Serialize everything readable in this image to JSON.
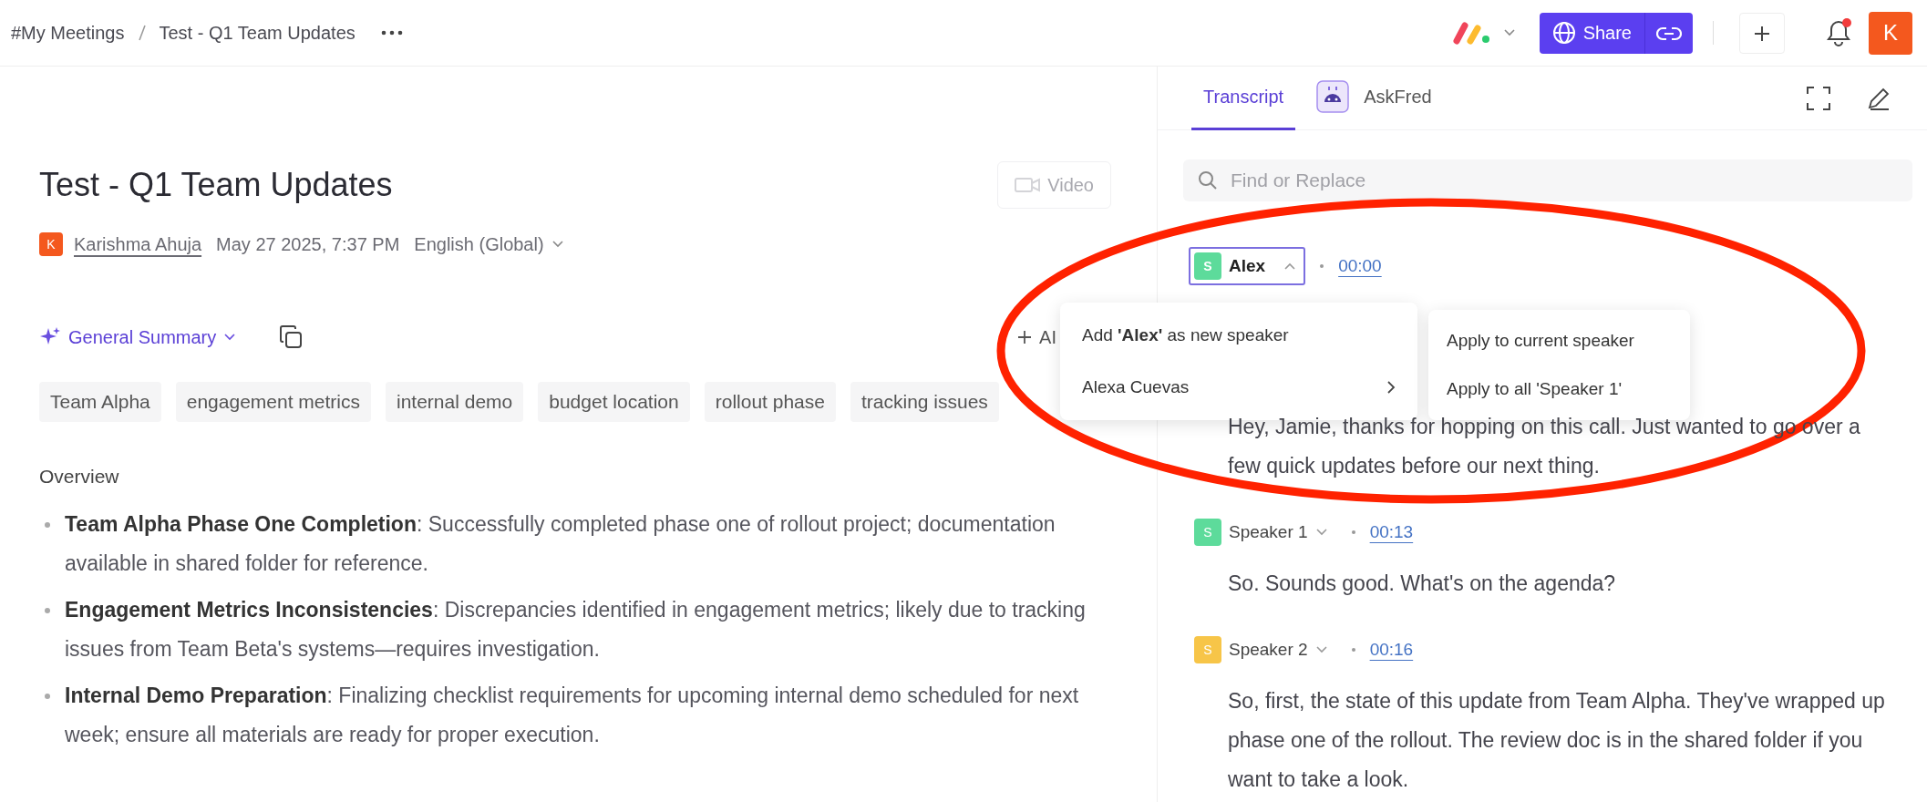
{
  "breadcrumb": [
    {
      "label": "#My Meetings"
    },
    {
      "label": "Test - Q1 Team Updates"
    }
  ],
  "topbar": {
    "share_label": "Share",
    "avatar": "K"
  },
  "meeting": {
    "title": "Test - Q1 Team Updates",
    "video": {
      "label": "Video",
      "disabled": true
    },
    "owner_initial": "K",
    "owner": "Karishma Ahuja",
    "date": "May 27 2025, 7:37 PM",
    "language": "English (Global)"
  },
  "summary": {
    "label": "General Summary",
    "ai_label": "AI",
    "tags": [
      "Team Alpha",
      "engagement metrics",
      "internal demo",
      "budget location",
      "rollout phase",
      "tracking issues"
    ],
    "section": "Overview",
    "bullets": [
      "**Team Alpha Phase One Completion**: Successfully completed phase one of rollout project; documentation available in shared folder for reference.",
      "**Engagement Metrics Inconsistencies**: Discrepancies identified in engagement metrics; likely due to tracking issues from Team Beta's systems—requires investigation.",
      "**Internal Demo Preparation**: Finalizing checklist requirements for upcoming internal demo scheduled for next week; ensure all materials are ready for proper execution."
    ]
  },
  "transcript": {
    "tabs": [
      {
        "label": "Transcript",
        "selected": true
      },
      {
        "label": "AskFred",
        "selected": false
      }
    ],
    "search": {
      "placeholder": "Find or Replace"
    },
    "entries": [
      {
        "speaker": "Alex",
        "initial": "S",
        "color": "#5ddb9b",
        "time": "00:00",
        "expanded": true,
        "text": "Hey, Jamie, thanks for hopping on this call. Just wanted to go over a few quick updates before our next thing."
      },
      {
        "speaker": "Speaker 1",
        "initial": "S",
        "color": "#5ddb9b",
        "time": "00:13",
        "expanded": false,
        "text": "So. Sounds good. What's on the agenda?"
      },
      {
        "speaker": "Speaker 2",
        "initial": "S",
        "color": "#f7c548",
        "time": "00:16",
        "expanded": false,
        "text": "So, first, the state of this update from Team Alpha. They've wrapped up phase one of the rollout. The review doc is in the shared folder if you want to take a look."
      }
    ]
  },
  "speaker_menu": {
    "items": [
      {
        "label": "Add **'Alex'** as new speaker",
        "has_submenu": false
      },
      {
        "label": "Alexa Cuevas",
        "has_submenu": true
      }
    ],
    "submenu": [
      "Apply to current speaker",
      "Apply to all 'Speaker 1'"
    ]
  }
}
